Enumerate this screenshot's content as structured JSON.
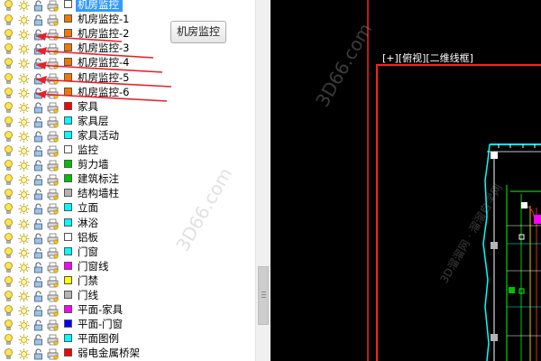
{
  "tooltip": {
    "label": "机房监控"
  },
  "viewport": {
    "label": "[+][俯视][二维线框]"
  },
  "layers": [
    {
      "name": "机房监控",
      "color": "#ffffff",
      "selected": true
    },
    {
      "name": "机房监控-1",
      "color": "#f07800"
    },
    {
      "name": "机房监控-2",
      "color": "#f07800"
    },
    {
      "name": "机房监控-3",
      "color": "#f07800"
    },
    {
      "name": "机房监控-4",
      "color": "#f07800"
    },
    {
      "name": "机房监控-5",
      "color": "#f07800"
    },
    {
      "name": "机房监控-6",
      "color": "#f07800"
    },
    {
      "name": "家具",
      "color": "#ff0000"
    },
    {
      "name": "家具层",
      "color": "#00ffff"
    },
    {
      "name": "家具活动",
      "color": "#00ffff"
    },
    {
      "name": "监控",
      "color": "#ffffff"
    },
    {
      "name": "剪力墙",
      "color": "#00c000"
    },
    {
      "name": "建筑标注",
      "color": "#00c000"
    },
    {
      "name": "结构墙柱",
      "color": "#b4b4b4"
    },
    {
      "name": "立面",
      "color": "#00ffff"
    },
    {
      "name": "淋浴",
      "color": "#00ffff"
    },
    {
      "name": "铝板",
      "color": "#ffffff"
    },
    {
      "name": "门窗",
      "color": "#00ffff"
    },
    {
      "name": "门窗线",
      "color": "#ff00ff"
    },
    {
      "name": "门禁",
      "color": "#ffff00"
    },
    {
      "name": "门线",
      "color": "#b4b4b4"
    },
    {
      "name": "平面-家具",
      "color": "#ff00ff"
    },
    {
      "name": "平面-门窗",
      "color": "#0000ff"
    },
    {
      "name": "平面图例",
      "color": "#00ffff"
    },
    {
      "name": "弱电金属桥架",
      "color": "#ff0000"
    }
  ],
  "watermarks": [
    "3D66.com",
    "3D66.com",
    "3D溜溜网 · 溜溜自学网"
  ],
  "colors": {
    "annotation_arrow": "#e8202a",
    "frame_red": "#ff2020",
    "selection": "#3399ff"
  }
}
